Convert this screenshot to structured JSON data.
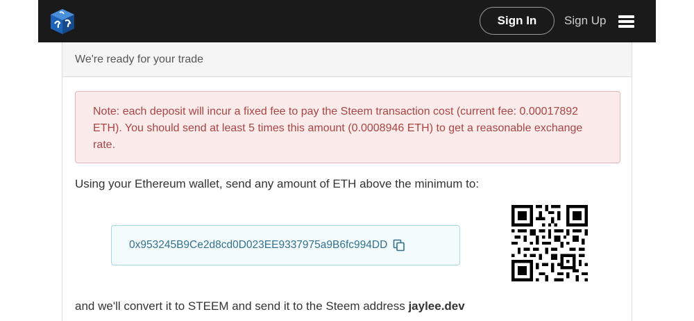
{
  "navbar": {
    "logo_icon": "steem-cube-logo",
    "sign_in_label": "Sign In",
    "sign_up_label": "Sign Up",
    "menu_icon": "hamburger-menu-icon"
  },
  "panel": {
    "heading": "We're ready for your trade",
    "alert_text": "Note: each deposit will incur a fixed fee to pay the Steem transaction cost (current fee: 0.00017892 ETH). You should send at least 5 times this amount (0.0008946 ETH) to get a reasonable exchange rate.",
    "instruction": "Using your Ethereum wallet, send any amount of ETH above the minimum to:",
    "deposit_address": "0x953245B9Ce2d8cd0D023EE9337975a9B6fc994DD",
    "copy_icon": "copy-icon",
    "qr_icon": "qr-code",
    "conversion_prefix": "and we'll convert it to STEEM and send it to the Steem address ",
    "steem_address": "jaylee.dev"
  },
  "colors": {
    "navbar_bg": "#1a1a1a",
    "alert_bg": "#fbebeb",
    "alert_text": "#a94442",
    "address_text": "#31708f"
  }
}
